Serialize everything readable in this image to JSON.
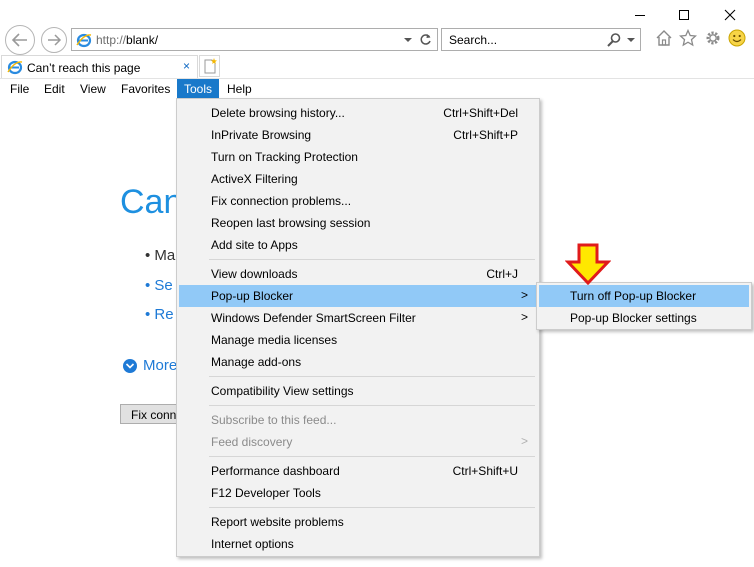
{
  "address": {
    "url_scheme": "http://",
    "url_host": "blank/"
  },
  "search": {
    "placeholder": "Search..."
  },
  "tab": {
    "title": "Can’t reach this page",
    "close": "×"
  },
  "menubar": [
    "File",
    "Edit",
    "View",
    "Favorites",
    "Tools",
    "Help"
  ],
  "background_page": {
    "heading": "Can",
    "item_1": "• Ma",
    "item_2": "• Se",
    "item_3": "• Re",
    "more": "More",
    "button": "Fix conn"
  },
  "tools_menu": {
    "items": [
      {
        "label": "Delete browsing history...",
        "shortcut": "Ctrl+Shift+Del"
      },
      {
        "label": "InPrivate Browsing",
        "shortcut": "Ctrl+Shift+P"
      },
      {
        "label": "Turn on Tracking Protection",
        "shortcut": ""
      },
      {
        "label": "ActiveX Filtering",
        "shortcut": ""
      },
      {
        "label": "Fix connection problems...",
        "shortcut": ""
      },
      {
        "label": "Reopen last browsing session",
        "shortcut": ""
      },
      {
        "label": "Add site to Apps",
        "shortcut": ""
      },
      {
        "label": "View downloads",
        "shortcut": "Ctrl+J"
      },
      {
        "label": "Pop-up Blocker",
        "shortcut": "",
        "submenu_arrow": ">"
      },
      {
        "label": "Windows Defender SmartScreen Filter",
        "shortcut": "",
        "submenu_arrow": ">"
      },
      {
        "label": "Manage media licenses",
        "shortcut": ""
      },
      {
        "label": "Manage add-ons",
        "shortcut": ""
      },
      {
        "label": "Compatibility View settings",
        "shortcut": ""
      },
      {
        "label": "Subscribe to this feed...",
        "shortcut": ""
      },
      {
        "label": "Feed discovery",
        "shortcut": "",
        "submenu_arrow": ">"
      },
      {
        "label": "Performance dashboard",
        "shortcut": "Ctrl+Shift+U"
      },
      {
        "label": "F12 Developer Tools",
        "shortcut": ""
      },
      {
        "label": "Report website problems",
        "shortcut": ""
      },
      {
        "label": "Internet options",
        "shortcut": ""
      }
    ]
  },
  "popup_submenu": {
    "items": [
      {
        "label": "Turn off Pop-up Blocker"
      },
      {
        "label": "Pop-up Blocker settings"
      }
    ]
  },
  "colors": {
    "menu_highlight": "#91c9f7",
    "menubar_active": "#1979ca",
    "link_blue": "#1e7ad6",
    "annotation_arrow": "#ffe800"
  },
  "icons": [
    "back-icon",
    "forward-icon",
    "ie-logo-icon",
    "dropdown-icon",
    "refresh-icon",
    "search-icon",
    "home-icon",
    "favorites-star-icon",
    "gear-icon",
    "smiley-icon",
    "minimize-icon",
    "maximize-icon",
    "close-icon",
    "new-tab-icon"
  ]
}
